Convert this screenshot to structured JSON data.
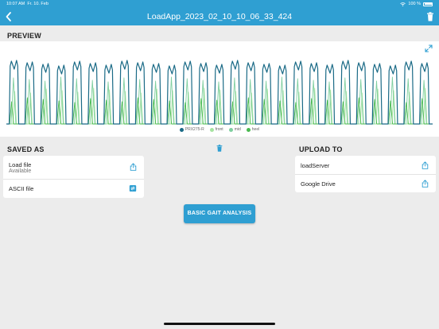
{
  "status": {
    "time": "10:07 AM",
    "date": "Fr. 10. Feb",
    "battery": "100 %"
  },
  "header": {
    "title": "LoadApp_2023_02_10_10_06_33_424"
  },
  "preview": {
    "title": "PREVIEW"
  },
  "chart_data": {
    "type": "line",
    "title": "",
    "legend_position": "bottom-center",
    "series": [
      {
        "name": "PRX275-R",
        "color": "#1a6a86"
      },
      {
        "name": "front",
        "color": "#a6e3a0"
      },
      {
        "name": "mid",
        "color": "#7fcf9f"
      },
      {
        "name": "heel",
        "color": "#49b94f"
      }
    ],
    "cycles": 27
  },
  "saved_as": {
    "title": "SAVED AS",
    "items": [
      {
        "label": "Load file",
        "sub": "Available"
      },
      {
        "label": "ASCII file",
        "sub": ""
      }
    ]
  },
  "upload_to": {
    "title": "UPLOAD TO",
    "items": [
      {
        "label": "loadServer"
      },
      {
        "label": "Google Drive"
      }
    ]
  },
  "actions": {
    "gait_button": "BASIC GAIT ANALYSIS"
  },
  "colors": {
    "accent": "#2f9fd2",
    "panel": "#ffffff",
    "background": "#ececec"
  }
}
